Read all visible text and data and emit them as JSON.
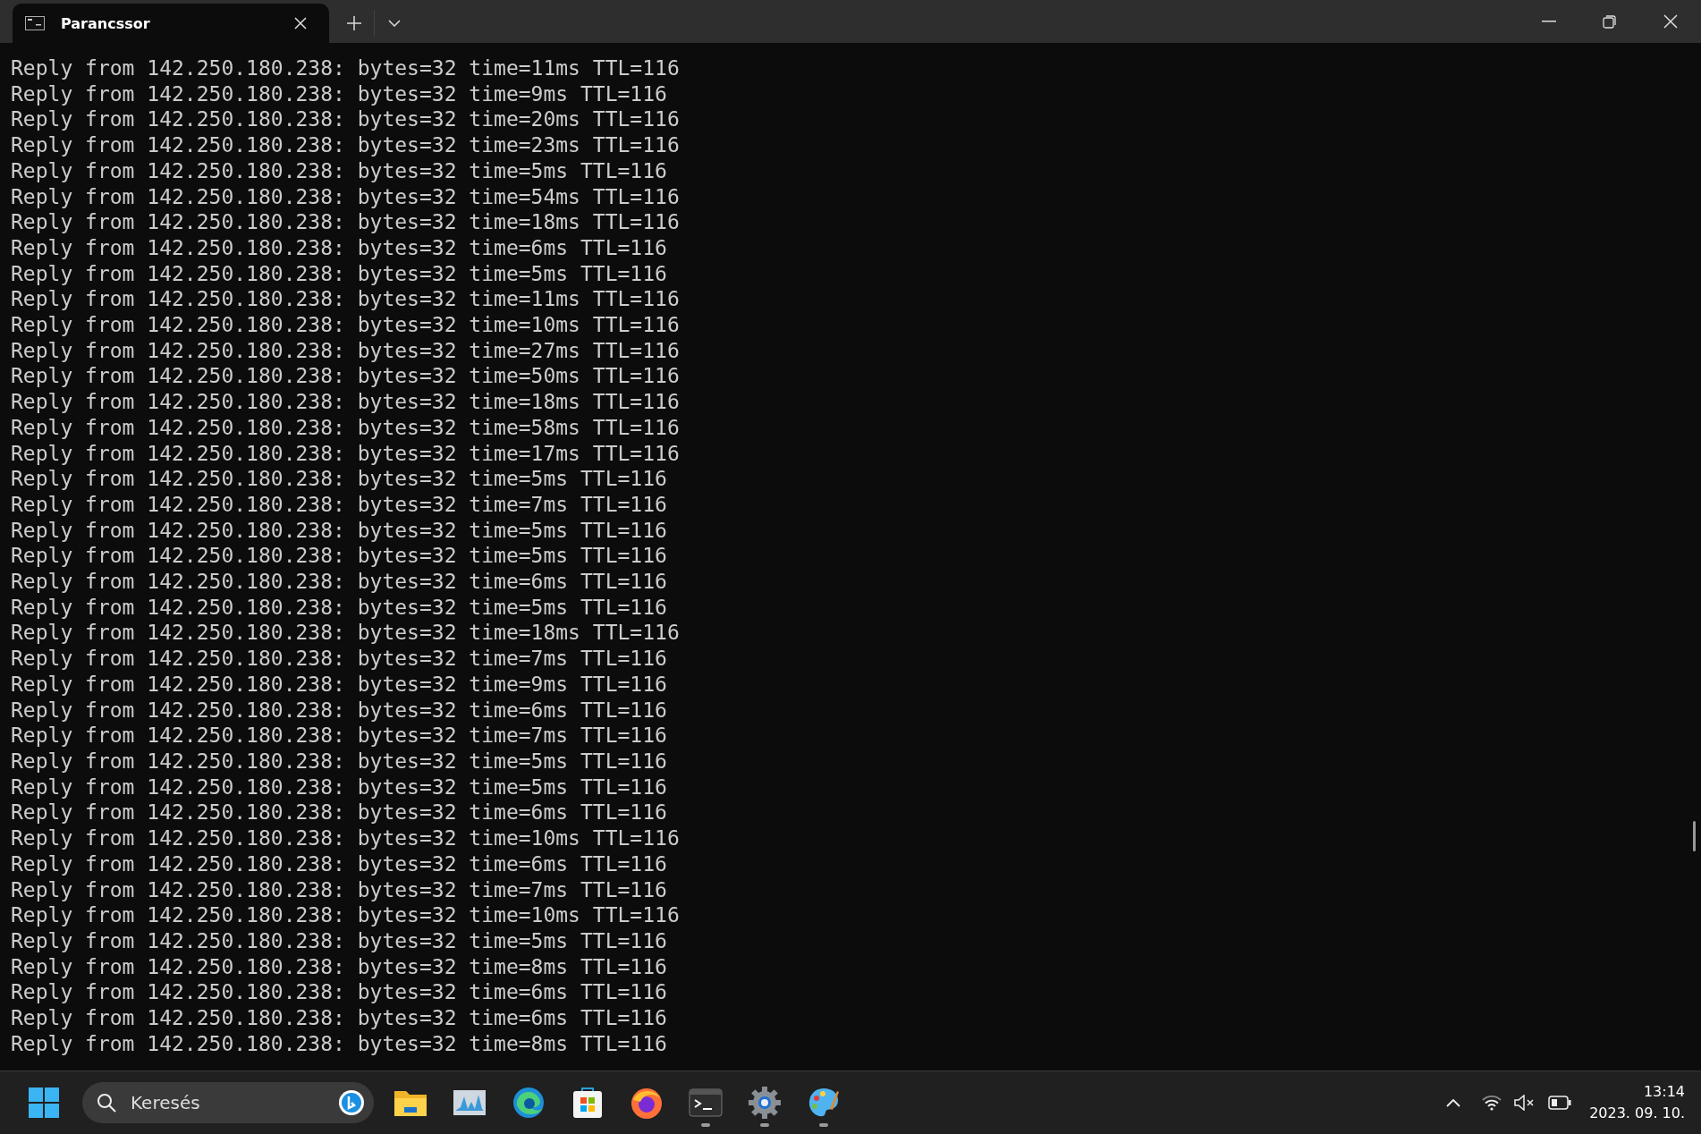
{
  "window": {
    "tab": {
      "title": "Parancssor",
      "selected": true
    }
  },
  "console": {
    "lines": [
      "Reply from 142.250.180.238: bytes=32 time=11ms TTL=116",
      "Reply from 142.250.180.238: bytes=32 time=9ms TTL=116",
      "Reply from 142.250.180.238: bytes=32 time=20ms TTL=116",
      "Reply from 142.250.180.238: bytes=32 time=23ms TTL=116",
      "Reply from 142.250.180.238: bytes=32 time=5ms TTL=116",
      "Reply from 142.250.180.238: bytes=32 time=54ms TTL=116",
      "Reply from 142.250.180.238: bytes=32 time=18ms TTL=116",
      "Reply from 142.250.180.238: bytes=32 time=6ms TTL=116",
      "Reply from 142.250.180.238: bytes=32 time=5ms TTL=116",
      "Reply from 142.250.180.238: bytes=32 time=11ms TTL=116",
      "Reply from 142.250.180.238: bytes=32 time=10ms TTL=116",
      "Reply from 142.250.180.238: bytes=32 time=27ms TTL=116",
      "Reply from 142.250.180.238: bytes=32 time=50ms TTL=116",
      "Reply from 142.250.180.238: bytes=32 time=18ms TTL=116",
      "Reply from 142.250.180.238: bytes=32 time=58ms TTL=116",
      "Reply from 142.250.180.238: bytes=32 time=17ms TTL=116",
      "Reply from 142.250.180.238: bytes=32 time=5ms TTL=116",
      "Reply from 142.250.180.238: bytes=32 time=7ms TTL=116",
      "Reply from 142.250.180.238: bytes=32 time=5ms TTL=116",
      "Reply from 142.250.180.238: bytes=32 time=5ms TTL=116",
      "Reply from 142.250.180.238: bytes=32 time=6ms TTL=116",
      "Reply from 142.250.180.238: bytes=32 time=5ms TTL=116",
      "Reply from 142.250.180.238: bytes=32 time=18ms TTL=116",
      "Reply from 142.250.180.238: bytes=32 time=7ms TTL=116",
      "Reply from 142.250.180.238: bytes=32 time=9ms TTL=116",
      "Reply from 142.250.180.238: bytes=32 time=6ms TTL=116",
      "Reply from 142.250.180.238: bytes=32 time=7ms TTL=116",
      "Reply from 142.250.180.238: bytes=32 time=5ms TTL=116",
      "Reply from 142.250.180.238: bytes=32 time=5ms TTL=116",
      "Reply from 142.250.180.238: bytes=32 time=6ms TTL=116",
      "Reply from 142.250.180.238: bytes=32 time=10ms TTL=116",
      "Reply from 142.250.180.238: bytes=32 time=6ms TTL=116",
      "Reply from 142.250.180.238: bytes=32 time=7ms TTL=116",
      "Reply from 142.250.180.238: bytes=32 time=10ms TTL=116",
      "Reply from 142.250.180.238: bytes=32 time=5ms TTL=116",
      "Reply from 142.250.180.238: bytes=32 time=8ms TTL=116",
      "Reply from 142.250.180.238: bytes=32 time=6ms TTL=116",
      "Reply from 142.250.180.238: bytes=32 time=6ms TTL=116",
      "Reply from 142.250.180.238: bytes=32 time=8ms TTL=116"
    ]
  },
  "taskbar": {
    "search": {
      "placeholder": "Keresés"
    },
    "apps": [
      {
        "kind": "folder",
        "running": false
      },
      {
        "kind": "monitor",
        "running": false
      },
      {
        "kind": "browser",
        "running": false
      },
      {
        "kind": "store",
        "running": false
      },
      {
        "kind": "fox",
        "running": false
      },
      {
        "kind": "terminal",
        "running": true
      },
      {
        "kind": "gear",
        "running": true
      },
      {
        "kind": "palette",
        "running": true
      }
    ],
    "clock": {
      "time": "13:14",
      "date": "2023. 09. 10."
    }
  }
}
